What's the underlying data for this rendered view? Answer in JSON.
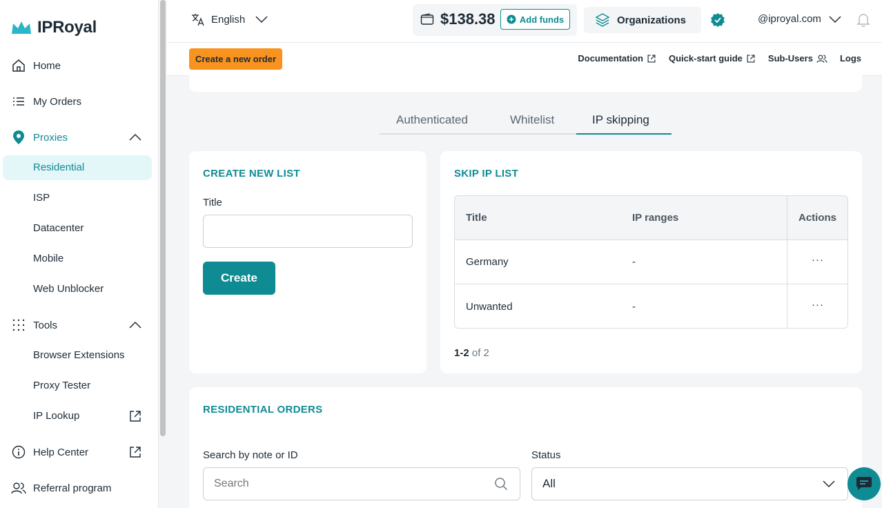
{
  "sidebar": {
    "brand": "IPRoyal",
    "home": "Home",
    "my_orders": "My Orders",
    "proxies": "Proxies",
    "proxy_items": [
      "Residential",
      "ISP",
      "Datacenter",
      "Mobile",
      "Web Unblocker"
    ],
    "tools": "Tools",
    "tool_items": [
      "Browser Extensions",
      "Proxy Tester",
      "IP Lookup"
    ],
    "help_center": "Help Center",
    "referral": "Referral program"
  },
  "topbar": {
    "language": "English",
    "balance": "$138.38",
    "add_funds": "Add funds",
    "organizations": "Organizations",
    "account": "@iproyal.com"
  },
  "subbar": {
    "create_order": "Create a new order",
    "documentation": "Documentation",
    "quick_start": "Quick-start guide",
    "sub_users": "Sub-Users",
    "logs": "Logs"
  },
  "tabs": [
    "Authenticated",
    "Whitelist",
    "IP skipping"
  ],
  "create_list": {
    "title": "CREATE NEW LIST",
    "field_label": "Title",
    "field_value": "",
    "button": "Create"
  },
  "skip_list": {
    "title": "SKIP IP LIST",
    "columns": [
      "Title",
      "IP ranges",
      "Actions"
    ],
    "rows": [
      {
        "title": "Germany",
        "ranges": "-",
        "actions": "···"
      },
      {
        "title": "Unwanted",
        "ranges": "-",
        "actions": "···"
      }
    ],
    "pager_range": "1-2",
    "pager_total": "of 2"
  },
  "orders": {
    "title": "RESIDENTIAL ORDERS",
    "search_label": "Search by note or ID",
    "search_placeholder": "Search",
    "status_label": "Status",
    "status_value": "All"
  },
  "colors": {
    "accent": "#0e8b93",
    "order_button": "#f7931e",
    "active_nav_bg": "#e3f6f8"
  }
}
